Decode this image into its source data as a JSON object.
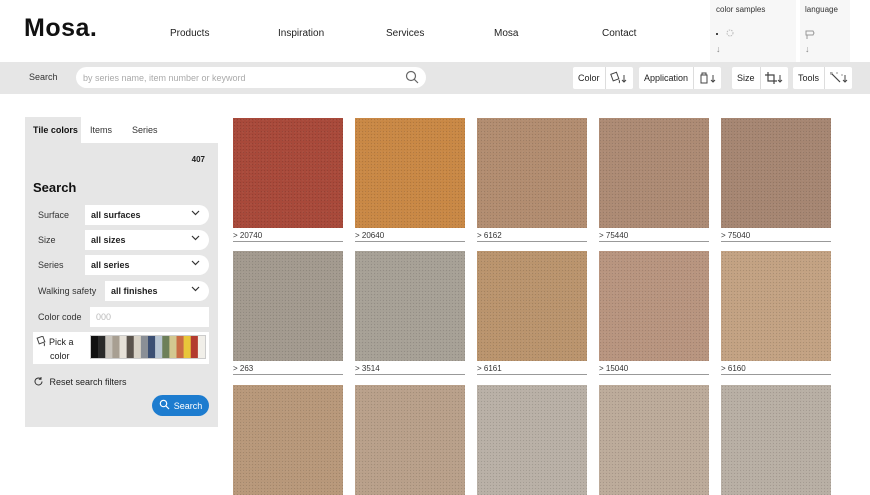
{
  "header": {
    "logo": "Mosa.",
    "nav": [
      "Products",
      "Inspiration",
      "Services",
      "Mosa",
      "Contact"
    ],
    "color_samples_label": "color samples",
    "language_label": "language",
    "color_samples_icon": "cart-icon",
    "language_icon": "globe-icon"
  },
  "searchbar": {
    "label": "Search",
    "placeholder": "by series name, item number or keyword",
    "tools": [
      {
        "label": "Color",
        "icon": "paint-bucket-icon"
      },
      {
        "label": "Application",
        "icon": "bucket-icon"
      },
      {
        "label": "Size",
        "icon": "crop-icon"
      },
      {
        "label": "Tools",
        "icon": "magic-wand-icon"
      }
    ]
  },
  "panel": {
    "tabs": [
      "Tile colors",
      "Items",
      "Series"
    ],
    "active_tab": "Tile colors",
    "count": "407",
    "title": "Search",
    "filters": [
      {
        "label": "Surface",
        "value": "all surfaces"
      },
      {
        "label": "Size",
        "value": "all sizes"
      },
      {
        "label": "Series",
        "value": "all series"
      },
      {
        "label": "Walking safety",
        "value": "all finishes"
      }
    ],
    "color_code_label": "Color code",
    "color_code_placeholder": "000",
    "pick_color_label_1": "Pick a",
    "pick_color_label_2": "color",
    "swatch_colors": [
      "#111111",
      "#2a2a2a",
      "#c9c4bc",
      "#a89f92",
      "#e6e1d8",
      "#5a534c",
      "#d8d2c6",
      "#8a8f96",
      "#3b4f73",
      "#b9c6d3",
      "#6d7f59",
      "#d3c890",
      "#c96b44",
      "#e8c63a",
      "#b33b2f",
      "#f1efe9"
    ],
    "reset_label": "Reset search filters",
    "search_button": "Search"
  },
  "tiles": [
    {
      "code": "20740",
      "color": "#a8493a"
    },
    {
      "code": "20640",
      "color": "#c98845"
    },
    {
      "code": "6162",
      "color": "#b28d70"
    },
    {
      "code": "75440",
      "color": "#ad8b74"
    },
    {
      "code": "75040",
      "color": "#a68672"
    },
    {
      "code": "263",
      "color": "#a39a8f"
    },
    {
      "code": "3514",
      "color": "#a7a196"
    },
    {
      "code": "6161",
      "color": "#ba946d"
    },
    {
      "code": "15040",
      "color": "#b8957f"
    },
    {
      "code": "6160",
      "color": "#c3a283"
    },
    {
      "code": "",
      "color": "#b8987a"
    },
    {
      "code": "",
      "color": "#b9a08a"
    },
    {
      "code": "",
      "color": "#b9b0a6"
    },
    {
      "code": "",
      "color": "#bcab9a"
    },
    {
      "code": "",
      "color": "#b8afa4"
    }
  ]
}
